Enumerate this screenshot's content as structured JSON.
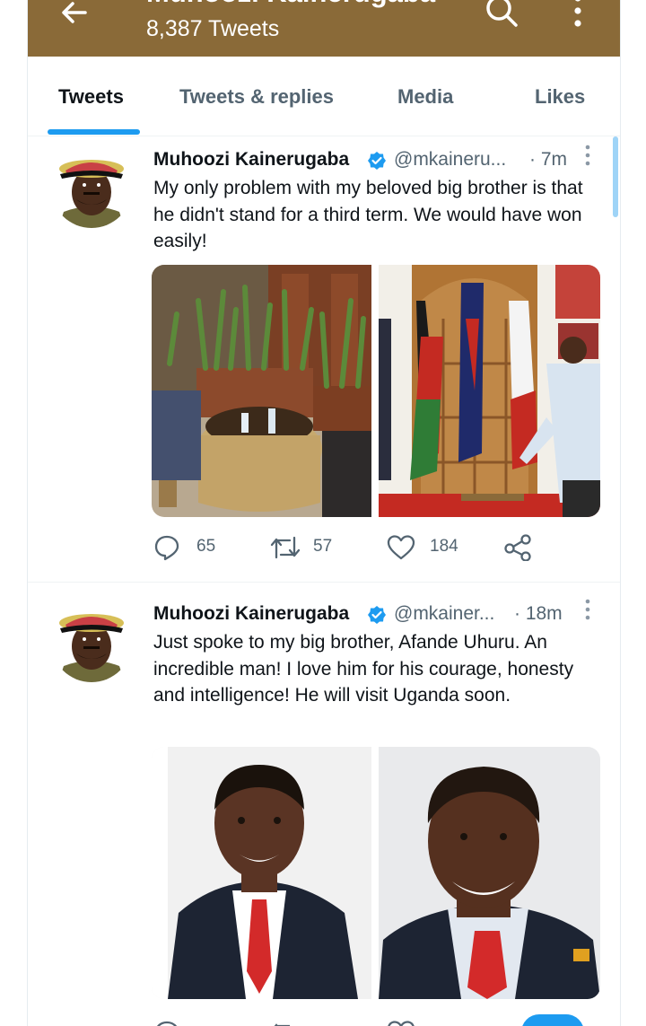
{
  "header": {
    "title": "Muhoozi Kainerugaba",
    "tweet_count": "8,387 Tweets",
    "bg_color": "#8a6a38"
  },
  "tabs": [
    {
      "label": "Tweets",
      "active": true
    },
    {
      "label": "Tweets & replies",
      "active": false
    },
    {
      "label": "Media",
      "active": false
    },
    {
      "label": "Likes",
      "active": false
    }
  ],
  "tweets": [
    {
      "name": "Muhoozi Kainerugaba",
      "handle": "@mkaineru...",
      "time": "· 7m",
      "text": "My only problem with my beloved big brother is that he didn't stand for a third term. We would have won easily!",
      "replies": "65",
      "retweets": "57",
      "likes": "184",
      "media": [
        "photo-lounge-plants-wicker-table",
        "photo-man-beside-flags-kenya"
      ]
    },
    {
      "name": "Muhoozi Kainerugaba",
      "handle": "@mkainer...",
      "time": "· 18m",
      "text": "Just spoke to my big brother, Afande Uhuru. An incredible man! I love him for his courage, honesty and intelligence! He will visit Uganda soon.",
      "media": [
        "photo-portrait-man-red-tie",
        "photo-portrait-man-smiling-red-tie"
      ]
    }
  ],
  "colors": {
    "accent": "#1d9bf0",
    "text": "#0f1419",
    "muted": "#536471"
  }
}
